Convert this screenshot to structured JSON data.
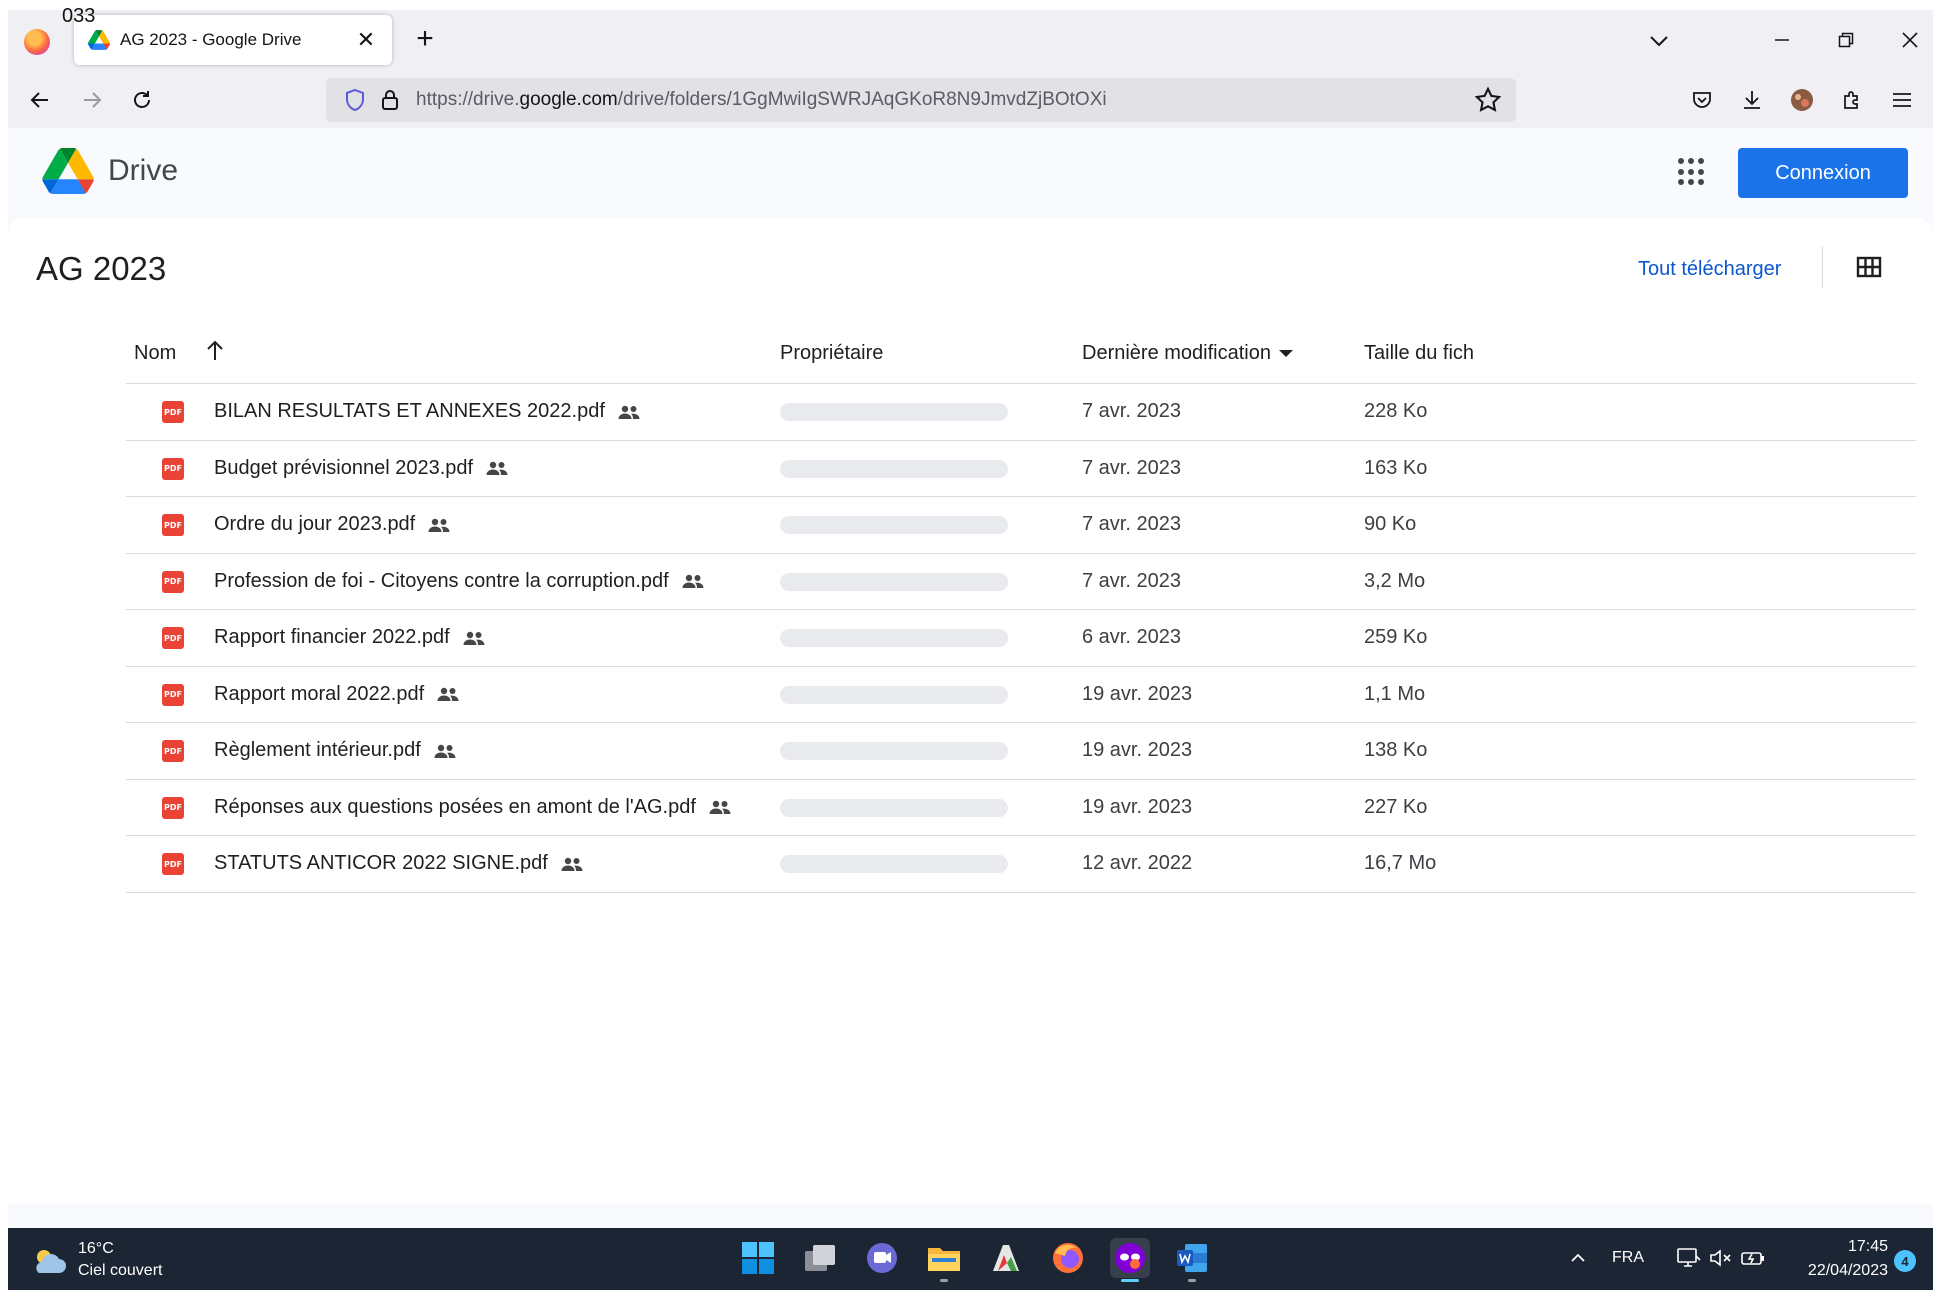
{
  "corner_label": "033",
  "browser": {
    "tab_title": "AG 2023 - Google Drive",
    "url_prefix": "https://drive.",
    "url_host": "google.com",
    "url_path": "/drive/folders/1GgMwiIgSWRJAqGKoR8N9JmvdZjBOtOXi",
    "icons": {
      "menu": "firefox-logo-icon",
      "new_tab": "plus-icon",
      "tab_list": "chevron-down-icon",
      "back": "back-arrow-icon",
      "forward": "forward-arrow-icon",
      "reload": "reload-icon",
      "shield": "tracking-protection-icon",
      "lock": "lock-icon",
      "bookmark": "star-icon",
      "pocket": "pocket-icon",
      "downloads": "download-icon",
      "account": "avatar-icon",
      "extensions": "puzzle-icon",
      "app_menu": "hamburger-icon"
    }
  },
  "drive": {
    "product_name": "Drive",
    "sign_in_label": "Connexion",
    "folder_title": "AG 2023",
    "download_all_label": "Tout télécharger",
    "accent_color": "#1a73e8",
    "columns": {
      "name": "Nom",
      "owner": "Propriétaire",
      "modified": "Dernière modification",
      "size": "Taille du fich"
    },
    "files": [
      {
        "name": "BILAN RESULTATS ET ANNEXES 2022.pdf",
        "modified": "7 avr. 2023",
        "size": "228 Ko",
        "icon_label": "PDF"
      },
      {
        "name": "Budget prévisionnel 2023.pdf",
        "modified": "7 avr. 2023",
        "size": "163 Ko",
        "icon_label": "PDF"
      },
      {
        "name": "Ordre du jour 2023.pdf",
        "modified": "7 avr. 2023",
        "size": "90 Ko",
        "icon_label": "PDF"
      },
      {
        "name": "Profession de foi - Citoyens contre la corruption.pdf",
        "modified": "7 avr. 2023",
        "size": "3,2 Mo",
        "icon_label": "PDF"
      },
      {
        "name": "Rapport financier 2022.pdf",
        "modified": "6 avr. 2023",
        "size": "259 Ko",
        "icon_label": "PDF"
      },
      {
        "name": "Rapport moral 2022.pdf",
        "modified": "19 avr. 2023",
        "size": "1,1 Mo",
        "icon_label": "PDF"
      },
      {
        "name": "Règlement intérieur.pdf",
        "modified": "19 avr. 2023",
        "size": "138 Ko",
        "icon_label": "PDF"
      },
      {
        "name": "Réponses aux questions posées en amont de l'AG.pdf",
        "modified": "19 avr. 2023",
        "size": "227 Ko",
        "icon_label": "PDF"
      },
      {
        "name": "STATUTS ANTICOR 2022 SIGNE.pdf",
        "modified": "12 avr. 2022",
        "size": "16,7 Mo",
        "icon_label": "PDF"
      }
    ]
  },
  "taskbar": {
    "weather_temp": "16°C",
    "weather_desc": "Ciel couvert",
    "language": "FRA",
    "time": "17:45",
    "date": "22/04/2023",
    "notification_count": "4",
    "apps": [
      "start-icon",
      "task-view-icon",
      "teams-chat-icon",
      "file-explorer-icon",
      "pdf-app-icon",
      "firefox-icon",
      "private-browsing-icon",
      "word-icon"
    ]
  }
}
